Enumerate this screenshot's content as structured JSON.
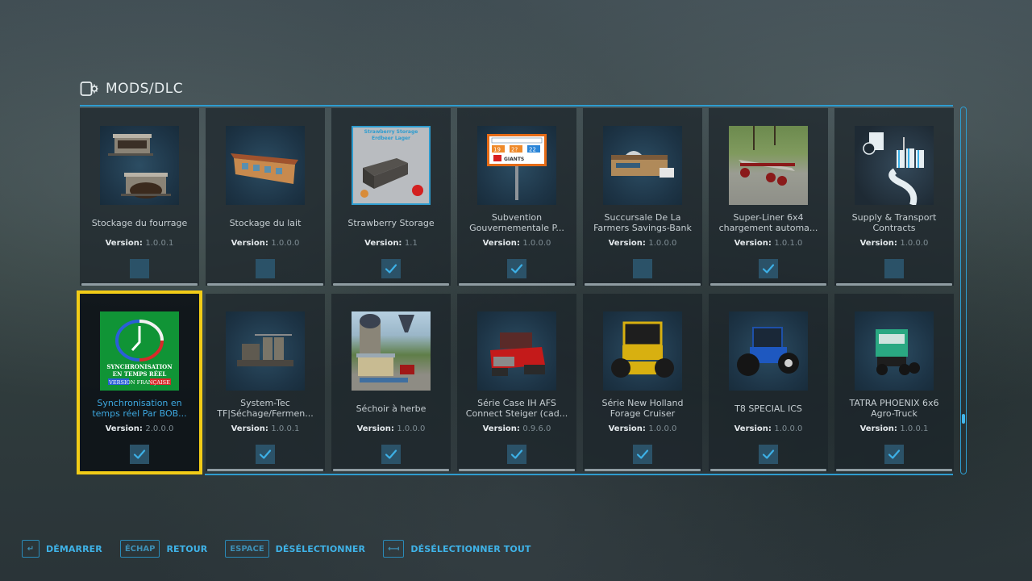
{
  "header": {
    "icon": "mods-dlc-icon",
    "title": "MODS/DLC"
  },
  "colors": {
    "accent": "#2e9ccf",
    "selected_outline": "#f2cc17",
    "checkbox_bg": "#2b5268",
    "check": "#3db0e6"
  },
  "mods": [
    {
      "name": "Stockage du fourrage",
      "version_label": "Version:",
      "version": "1.0.0.1",
      "checked": false,
      "thumb": "shelter"
    },
    {
      "name": "Stockage du lait",
      "version_label": "Version:",
      "version": "1.0.0.0",
      "checked": false,
      "thumb": "barn"
    },
    {
      "name": "Strawberry Storage",
      "version_label": "Version:",
      "version": "1.1",
      "checked": true,
      "thumb": "strawberry",
      "thumb_text": "Strawberry Storage Erdbeer Lager"
    },
    {
      "name": "Subvention Gouvernementale P...",
      "version_label": "Version:",
      "version": "1.0.0.0",
      "checked": true,
      "thumb": "sign",
      "thumb_text": [
        "19",
        "2?",
        "22",
        "GIANTS"
      ]
    },
    {
      "name": "Succursale De La Farmers Savings-Bank",
      "version_label": "Version:",
      "version": "1.0.0.0",
      "checked": false,
      "thumb": "bank"
    },
    {
      "name": "Super-Liner 6x4 chargement automa...",
      "version_label": "Version:",
      "version": "1.0.1.0",
      "checked": true,
      "thumb": "trailer"
    },
    {
      "name": "Supply & Transport Contracts",
      "version_label": "Version:",
      "version": "1.0.0.0",
      "checked": false,
      "thumb": "silos"
    },
    {
      "name": "Synchronisation en temps réel Par BOB...",
      "version_label": "Version:",
      "version": "2.0.0.0",
      "checked": true,
      "selected": true,
      "thumb": "clock",
      "thumb_text": [
        "SYNCHRONISATION",
        "EN TEMPS RÉEL",
        "VERSION FRANÇAISE"
      ]
    },
    {
      "name": "System-Tec TF|Séchage/Fermen...",
      "version_label": "Version:",
      "version": "1.0.0.1",
      "checked": true,
      "thumb": "plant"
    },
    {
      "name": "Séchoir à herbe",
      "version_label": "Version:",
      "version": "1.0.0.0",
      "checked": true,
      "thumb": "dryer"
    },
    {
      "name": "Série Case IH AFS Connect Steiger (cad...",
      "version_label": "Version:",
      "version": "0.9.6.0",
      "checked": true,
      "thumb": "red-tractor"
    },
    {
      "name": "Série New Holland Forage Cruiser",
      "version_label": "Version:",
      "version": "1.0.0.0",
      "checked": true,
      "thumb": "harvester"
    },
    {
      "name": "T8 SPECIAL ICS",
      "version_label": "Version:",
      "version": "1.0.0.0",
      "checked": true,
      "thumb": "blue-tractor"
    },
    {
      "name": "TATRA PHOENIX 6x6 Agro-Truck",
      "version_label": "Version:",
      "version": "1.0.0.1",
      "checked": true,
      "thumb": "truck"
    }
  ],
  "scrollbar": {
    "position_fraction": 0.86
  },
  "footer": [
    {
      "key": "↵",
      "label": "DÉMARRER",
      "icon": "enter-key-icon"
    },
    {
      "key": "ÉCHAP",
      "label": "RETOUR"
    },
    {
      "key": "ESPACE",
      "label": "DÉSÉLECTIONNER"
    },
    {
      "key": "⟻",
      "label": "DÉSÉLECTIONNER TOUT",
      "icon": "backspace-key-icon"
    }
  ]
}
